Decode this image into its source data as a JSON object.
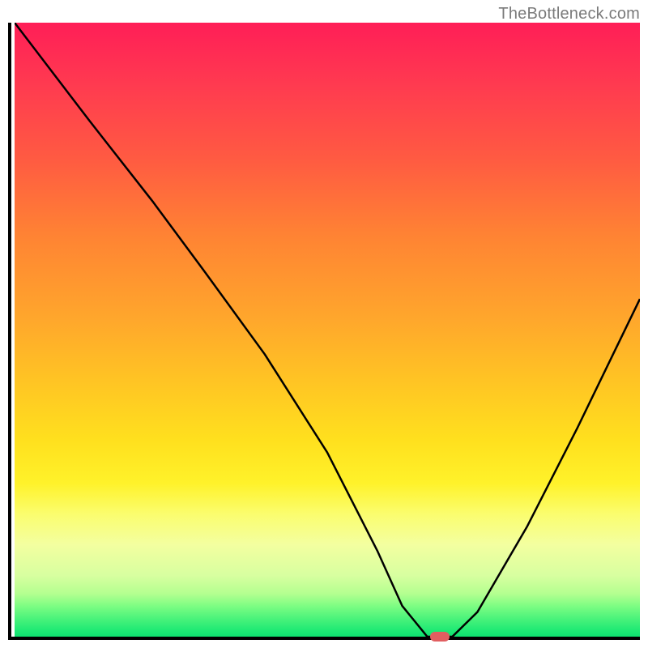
{
  "watermark": "TheBottleneck.com",
  "chart_data": {
    "type": "line",
    "title": "",
    "xlabel": "",
    "ylabel": "",
    "xlim": [
      0,
      100
    ],
    "ylim": [
      0,
      100
    ],
    "grid": false,
    "legend": false,
    "series": [
      {
        "name": "curve",
        "x": [
          0,
          12,
          22,
          30,
          40,
          50,
          58,
          62,
          66,
          70,
          74,
          82,
          90,
          100
        ],
        "y": [
          100,
          84,
          71,
          60,
          46,
          30,
          14,
          5,
          0,
          0,
          4,
          18,
          34,
          55
        ]
      }
    ],
    "marker": {
      "x": 68,
      "y": 0,
      "color": "#e15e60"
    }
  }
}
